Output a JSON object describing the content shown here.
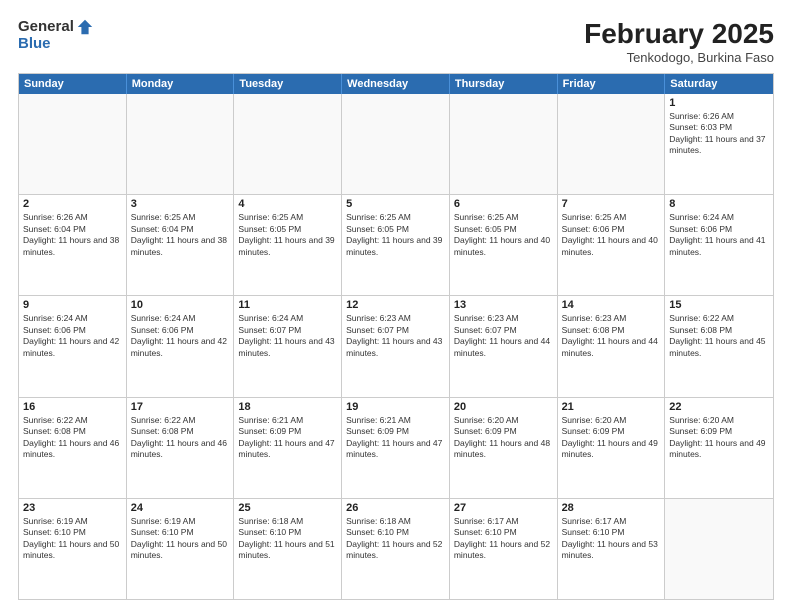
{
  "header": {
    "logo_general": "General",
    "logo_blue": "Blue",
    "title": "February 2025",
    "subtitle": "Tenkodogo, Burkina Faso"
  },
  "days_of_week": [
    "Sunday",
    "Monday",
    "Tuesday",
    "Wednesday",
    "Thursday",
    "Friday",
    "Saturday"
  ],
  "weeks": [
    [
      {
        "day": "",
        "info": ""
      },
      {
        "day": "",
        "info": ""
      },
      {
        "day": "",
        "info": ""
      },
      {
        "day": "",
        "info": ""
      },
      {
        "day": "",
        "info": ""
      },
      {
        "day": "",
        "info": ""
      },
      {
        "day": "1",
        "info": "Sunrise: 6:26 AM\nSunset: 6:03 PM\nDaylight: 11 hours and 37 minutes."
      }
    ],
    [
      {
        "day": "2",
        "info": "Sunrise: 6:26 AM\nSunset: 6:04 PM\nDaylight: 11 hours and 38 minutes."
      },
      {
        "day": "3",
        "info": "Sunrise: 6:25 AM\nSunset: 6:04 PM\nDaylight: 11 hours and 38 minutes."
      },
      {
        "day": "4",
        "info": "Sunrise: 6:25 AM\nSunset: 6:05 PM\nDaylight: 11 hours and 39 minutes."
      },
      {
        "day": "5",
        "info": "Sunrise: 6:25 AM\nSunset: 6:05 PM\nDaylight: 11 hours and 39 minutes."
      },
      {
        "day": "6",
        "info": "Sunrise: 6:25 AM\nSunset: 6:05 PM\nDaylight: 11 hours and 40 minutes."
      },
      {
        "day": "7",
        "info": "Sunrise: 6:25 AM\nSunset: 6:06 PM\nDaylight: 11 hours and 40 minutes."
      },
      {
        "day": "8",
        "info": "Sunrise: 6:24 AM\nSunset: 6:06 PM\nDaylight: 11 hours and 41 minutes."
      }
    ],
    [
      {
        "day": "9",
        "info": "Sunrise: 6:24 AM\nSunset: 6:06 PM\nDaylight: 11 hours and 42 minutes."
      },
      {
        "day": "10",
        "info": "Sunrise: 6:24 AM\nSunset: 6:06 PM\nDaylight: 11 hours and 42 minutes."
      },
      {
        "day": "11",
        "info": "Sunrise: 6:24 AM\nSunset: 6:07 PM\nDaylight: 11 hours and 43 minutes."
      },
      {
        "day": "12",
        "info": "Sunrise: 6:23 AM\nSunset: 6:07 PM\nDaylight: 11 hours and 43 minutes."
      },
      {
        "day": "13",
        "info": "Sunrise: 6:23 AM\nSunset: 6:07 PM\nDaylight: 11 hours and 44 minutes."
      },
      {
        "day": "14",
        "info": "Sunrise: 6:23 AM\nSunset: 6:08 PM\nDaylight: 11 hours and 44 minutes."
      },
      {
        "day": "15",
        "info": "Sunrise: 6:22 AM\nSunset: 6:08 PM\nDaylight: 11 hours and 45 minutes."
      }
    ],
    [
      {
        "day": "16",
        "info": "Sunrise: 6:22 AM\nSunset: 6:08 PM\nDaylight: 11 hours and 46 minutes."
      },
      {
        "day": "17",
        "info": "Sunrise: 6:22 AM\nSunset: 6:08 PM\nDaylight: 11 hours and 46 minutes."
      },
      {
        "day": "18",
        "info": "Sunrise: 6:21 AM\nSunset: 6:09 PM\nDaylight: 11 hours and 47 minutes."
      },
      {
        "day": "19",
        "info": "Sunrise: 6:21 AM\nSunset: 6:09 PM\nDaylight: 11 hours and 47 minutes."
      },
      {
        "day": "20",
        "info": "Sunrise: 6:20 AM\nSunset: 6:09 PM\nDaylight: 11 hours and 48 minutes."
      },
      {
        "day": "21",
        "info": "Sunrise: 6:20 AM\nSunset: 6:09 PM\nDaylight: 11 hours and 49 minutes."
      },
      {
        "day": "22",
        "info": "Sunrise: 6:20 AM\nSunset: 6:09 PM\nDaylight: 11 hours and 49 minutes."
      }
    ],
    [
      {
        "day": "23",
        "info": "Sunrise: 6:19 AM\nSunset: 6:10 PM\nDaylight: 11 hours and 50 minutes."
      },
      {
        "day": "24",
        "info": "Sunrise: 6:19 AM\nSunset: 6:10 PM\nDaylight: 11 hours and 50 minutes."
      },
      {
        "day": "25",
        "info": "Sunrise: 6:18 AM\nSunset: 6:10 PM\nDaylight: 11 hours and 51 minutes."
      },
      {
        "day": "26",
        "info": "Sunrise: 6:18 AM\nSunset: 6:10 PM\nDaylight: 11 hours and 52 minutes."
      },
      {
        "day": "27",
        "info": "Sunrise: 6:17 AM\nSunset: 6:10 PM\nDaylight: 11 hours and 52 minutes."
      },
      {
        "day": "28",
        "info": "Sunrise: 6:17 AM\nSunset: 6:10 PM\nDaylight: 11 hours and 53 minutes."
      },
      {
        "day": "",
        "info": ""
      }
    ]
  ]
}
